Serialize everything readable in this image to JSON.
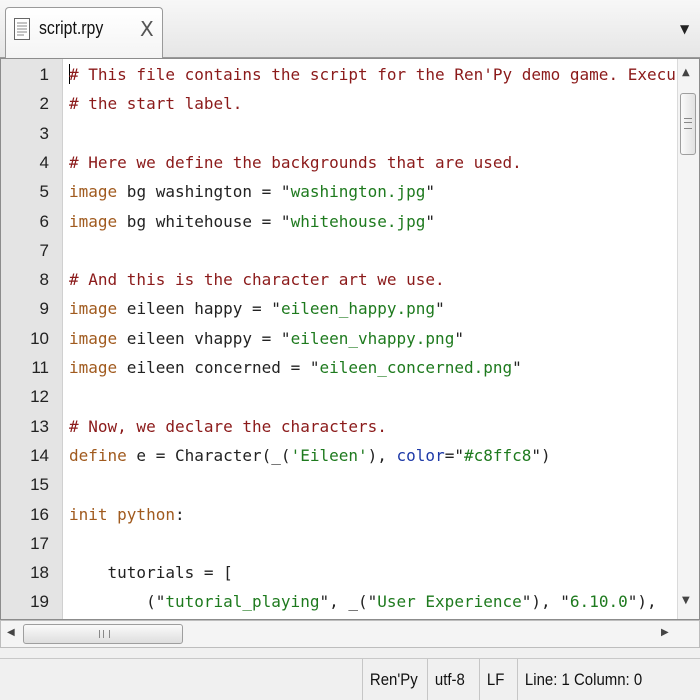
{
  "tab": {
    "title": "script.rpy",
    "close_glyph": "X",
    "icon": "document-icon",
    "menu_glyph": "▼"
  },
  "editor": {
    "line_numbers": [
      "1",
      "2",
      "3",
      "4",
      "5",
      "6",
      "7",
      "8",
      "9",
      "10",
      "11",
      "12",
      "13",
      "14",
      "15",
      "16",
      "17",
      "18",
      "19"
    ],
    "lines": [
      [
        {
          "t": "comment",
          "v": "# This file contains the script for the Ren'Py demo game. Executio"
        }
      ],
      [
        {
          "t": "comment",
          "v": "# the start label."
        }
      ],
      [],
      [
        {
          "t": "comment",
          "v": "# Here we define the backgrounds that are used."
        }
      ],
      [
        {
          "t": "keyword",
          "v": "image"
        },
        {
          "t": "plain",
          "v": " bg washington = \""
        },
        {
          "t": "string",
          "v": "washington.jpg"
        },
        {
          "t": "plain",
          "v": "\""
        }
      ],
      [
        {
          "t": "keyword",
          "v": "image"
        },
        {
          "t": "plain",
          "v": " bg whitehouse = \""
        },
        {
          "t": "string",
          "v": "whitehouse.jpg"
        },
        {
          "t": "plain",
          "v": "\""
        }
      ],
      [],
      [
        {
          "t": "comment",
          "v": "# And this is the character art we use."
        }
      ],
      [
        {
          "t": "keyword",
          "v": "image"
        },
        {
          "t": "plain",
          "v": " eileen happy = \""
        },
        {
          "t": "string",
          "v": "eileen_happy.png"
        },
        {
          "t": "plain",
          "v": "\""
        }
      ],
      [
        {
          "t": "keyword",
          "v": "image"
        },
        {
          "t": "plain",
          "v": " eileen vhappy = \""
        },
        {
          "t": "string",
          "v": "eileen_vhappy.png"
        },
        {
          "t": "plain",
          "v": "\""
        }
      ],
      [
        {
          "t": "keyword",
          "v": "image"
        },
        {
          "t": "plain",
          "v": " eileen concerned = \""
        },
        {
          "t": "string",
          "v": "eileen_concerned.png"
        },
        {
          "t": "plain",
          "v": "\""
        }
      ],
      [],
      [
        {
          "t": "comment",
          "v": "# Now, we declare the characters."
        }
      ],
      [
        {
          "t": "keyword",
          "v": "define"
        },
        {
          "t": "plain",
          "v": " e = Character(_("
        },
        {
          "t": "string",
          "v": "'Eileen'"
        },
        {
          "t": "plain",
          "v": "), "
        },
        {
          "t": "attr",
          "v": "color"
        },
        {
          "t": "plain",
          "v": "=\""
        },
        {
          "t": "string",
          "v": "#c8ffc8"
        },
        {
          "t": "plain",
          "v": "\")"
        }
      ],
      [],
      [
        {
          "t": "keyword",
          "v": "init python"
        },
        {
          "t": "plain",
          "v": ":"
        }
      ],
      [],
      [
        {
          "t": "plain",
          "v": "    tutorials = ["
        }
      ],
      [
        {
          "t": "plain",
          "v": "        (\""
        },
        {
          "t": "string",
          "v": "tutorial_playing"
        },
        {
          "t": "plain",
          "v": "\", _(\""
        },
        {
          "t": "string",
          "v": "User Experience"
        },
        {
          "t": "plain",
          "v": "\"), \""
        },
        {
          "t": "string",
          "v": "6.10.0"
        },
        {
          "t": "plain",
          "v": "\"),"
        }
      ]
    ]
  },
  "scrollbars": {
    "vertical_up": "▲",
    "vertical_down": "▼",
    "horizontal_left": "◀",
    "horizontal_right": "▶"
  },
  "status": {
    "language": "Ren'Py",
    "encoding": "utf-8",
    "line_ending": "LF",
    "position": "Line: 1  Column: 0"
  },
  "colors": {
    "comment": "#8b1a1a",
    "keyword": "#a05a1e",
    "string": "#1e7a1e",
    "attribute": "#1e3aa8",
    "gutter": "#e4e4e4"
  }
}
